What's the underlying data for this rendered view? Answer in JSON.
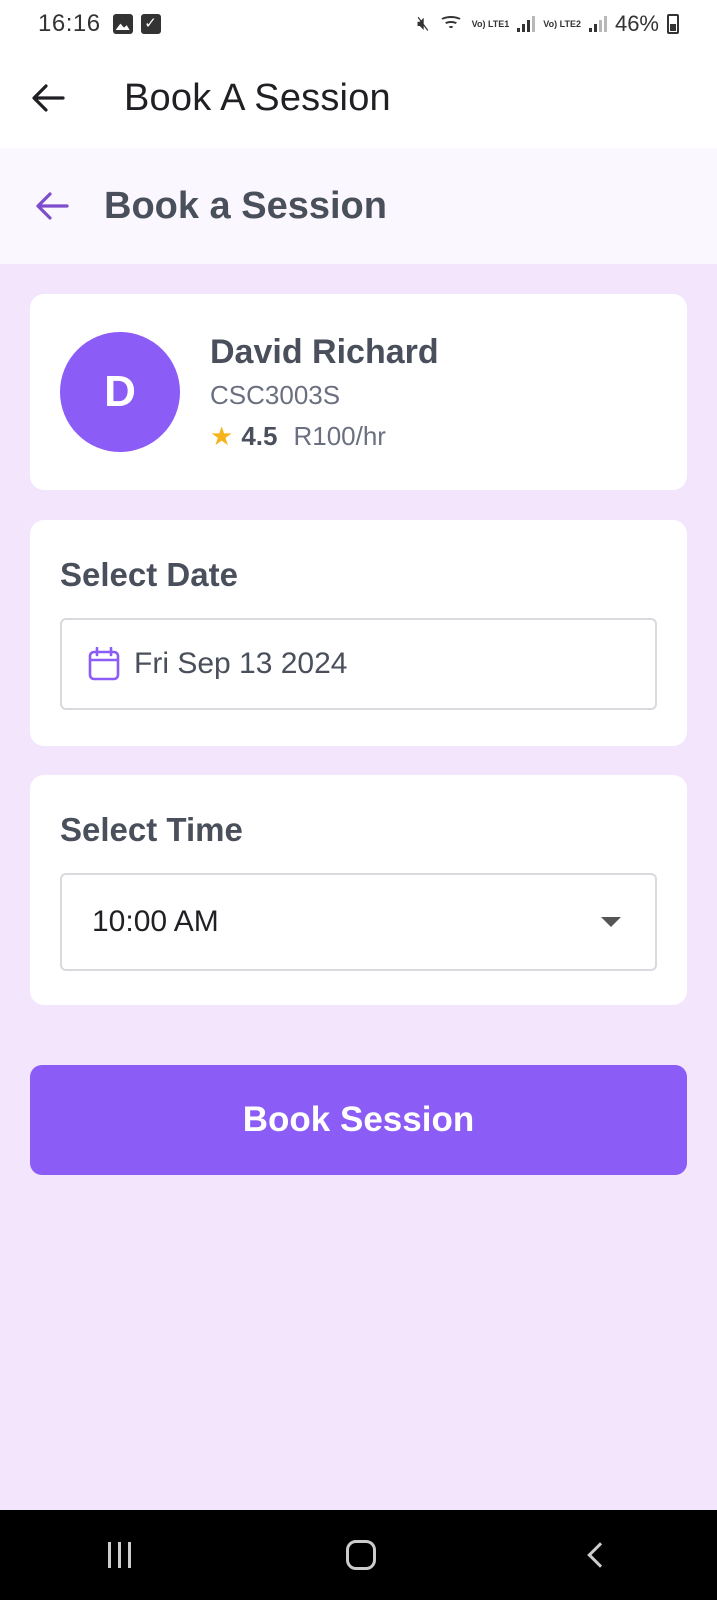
{
  "status_bar": {
    "time": "16:16",
    "network_1": "Vo) LTE1",
    "network_2": "Vo) LTE2",
    "battery": "46%"
  },
  "app_bar": {
    "title": "Book A Session"
  },
  "header": {
    "title": "Book a Session",
    "accent_color": "#7c4dcc"
  },
  "tutor": {
    "initial": "D",
    "name": "David Richard",
    "course": "CSC3003S",
    "rating": "4.5",
    "rate": "R100/hr",
    "avatar_color": "#8b5cf6",
    "star_color": "#f6b41c"
  },
  "date_section": {
    "title": "Select Date",
    "value": "Fri Sep 13 2024"
  },
  "time_section": {
    "title": "Select Time",
    "value": "10:00 AM"
  },
  "actions": {
    "book_label": "Book Session",
    "button_color": "#8b5cf6"
  },
  "icons": [
    "back-arrow-icon",
    "calendar-icon",
    "star-icon",
    "dropdown-arrow-icon"
  ]
}
